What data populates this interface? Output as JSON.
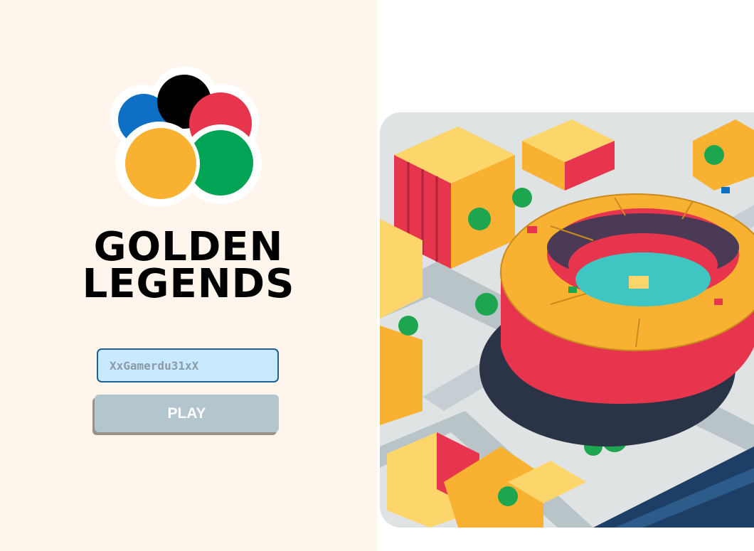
{
  "game": {
    "title_line1": "GOLDEN",
    "title_line2": "LEGENDS"
  },
  "login": {
    "username_placeholder": "XxGamerdu31xX",
    "play_label": "PLAY"
  },
  "colors": {
    "background": "#fef6ec",
    "logo_blue": "#0d70c4",
    "logo_black": "#000000",
    "logo_red": "#e8354e",
    "logo_yellow": "#f9b131",
    "logo_green": "#00a454",
    "input_bg": "#c8e9ff",
    "input_border": "#1f5f8c",
    "button_bg": "#b3c5cd"
  },
  "icons": {
    "logo": "five-rings-logo",
    "illustration": "isometric-stadium-city-illustration"
  }
}
